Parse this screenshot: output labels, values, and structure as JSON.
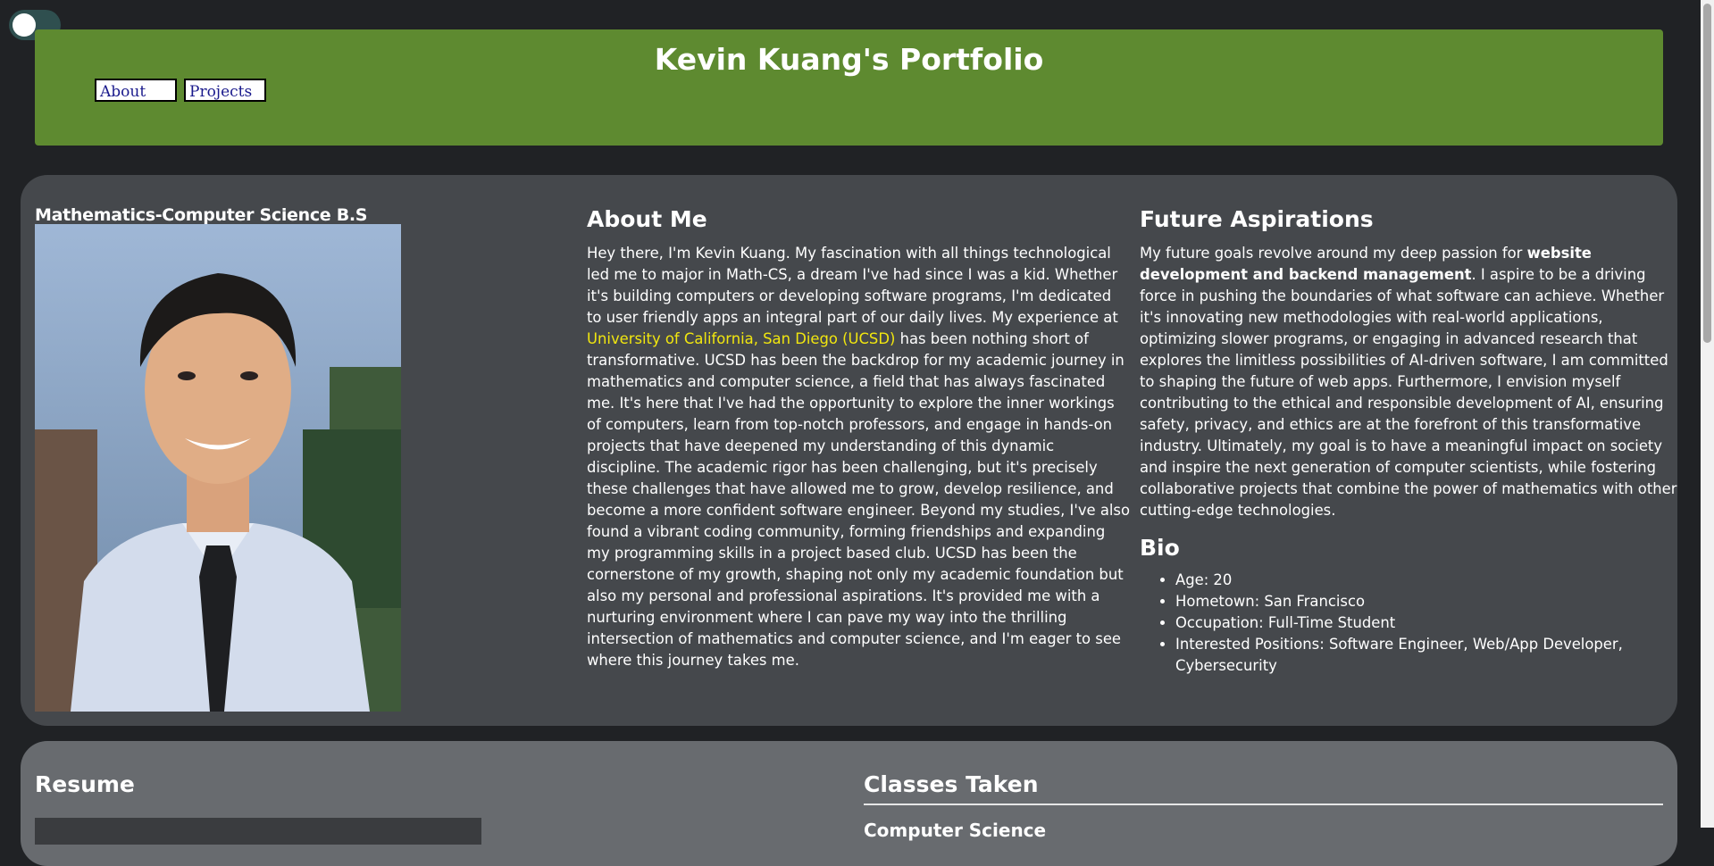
{
  "header": {
    "title": "Kevin Kuang's Portfolio",
    "nav": [
      {
        "label": "About"
      },
      {
        "label": "Projects"
      }
    ],
    "color": "#5e8a30"
  },
  "profile": {
    "degree": "Mathematics-Computer Science B.S"
  },
  "about": {
    "heading": "About Me",
    "text_before_link": "Hey there, I'm Kevin Kuang. My fascination with all things technological led me to major in Math-CS, a dream I've had since I was a kid. Whether it's building computers or developing software programs, I'm dedicated to user friendly apps an integral part of our daily lives. My experience at ",
    "link": "University of California, San Diego (UCSD)",
    "text_after_link": " has been nothing short of transformative. UCSD has been the backdrop for my academic journey in mathematics and computer science, a field that has always fascinated me. It's here that I've had the opportunity to explore the inner workings of computers, learn from top-notch professors, and engage in hands-on projects that have deepened my understanding of this dynamic discipline. The academic rigor has been challenging, but it's precisely these challenges that have allowed me to grow, develop resilience, and become a more confident software engineer. Beyond my studies, I've also found a vibrant coding community, forming friendships and expanding my programming skills in a project based club. UCSD has been the cornerstone of my growth, shaping not only my academic foundation but also my personal and professional aspirations. It's provided me with a nurturing environment where I can pave my way into the thrilling intersection of mathematics and computer science, and I'm eager to see where this journey takes me."
  },
  "future": {
    "heading": "Future Aspirations",
    "text_before_bold": "My future goals revolve around my deep passion for ",
    "bold": "website development and backend management",
    "text_after_bold": ". I aspire to be a driving force in pushing the boundaries of what software can achieve. Whether it's innovating new methodologies with real-world applications, optimizing slower programs, or engaging in advanced research that explores the limitless possibilities of AI-driven software, I am committed to shaping the future of web apps. Furthermore, I envision myself contributing to the ethical and responsible development of AI, ensuring safety, privacy, and ethics are at the forefront of this transformative industry. Ultimately, my goal is to have a meaningful impact on society and inspire the next generation of computer scientists, while fostering collaborative projects that combine the power of mathematics with other cutting-edge technologies."
  },
  "bio": {
    "heading": "Bio",
    "items": [
      "Age: 20",
      "Hometown: San Francisco",
      "Occupation: Full-Time Student",
      "Interested Positions: Software Engineer, Web/App Developer, Cybersecurity"
    ]
  },
  "lower": {
    "resume_heading": "Resume",
    "classes_heading": "Classes Taken",
    "classes_sub": "Computer Science"
  }
}
